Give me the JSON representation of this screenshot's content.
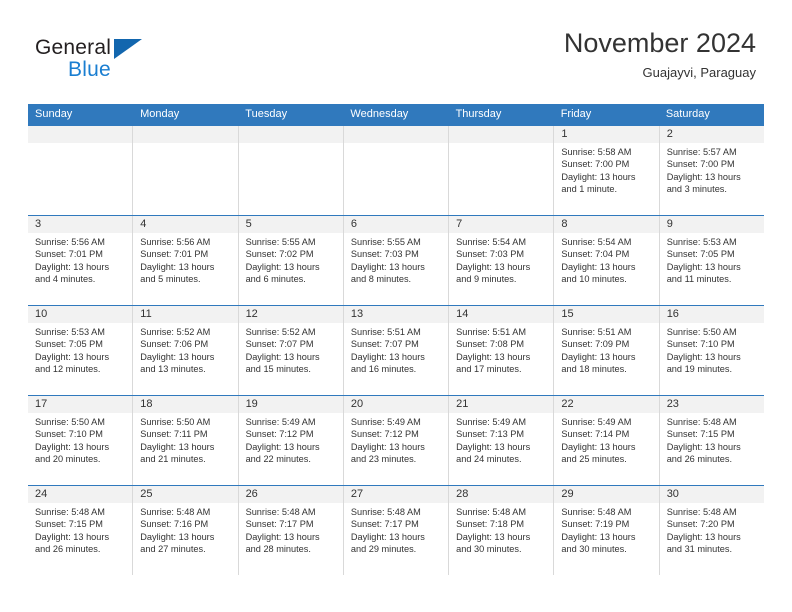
{
  "brand": {
    "name_part1": "General",
    "name_part2": "Blue",
    "accent_color": "#1a7ed1",
    "triangle_color": "#1266ae"
  },
  "header": {
    "title": "November 2024",
    "subtitle": "Guajayvi, Paraguay"
  },
  "calendar": {
    "header_bg": "#3079bd",
    "date_band_bg": "#f2f2f2",
    "weekdays": [
      "Sunday",
      "Monday",
      "Tuesday",
      "Wednesday",
      "Thursday",
      "Friday",
      "Saturday"
    ],
    "weeks": [
      [
        {
          "date": "",
          "sunrise": "",
          "sunset": "",
          "daylight": ""
        },
        {
          "date": "",
          "sunrise": "",
          "sunset": "",
          "daylight": ""
        },
        {
          "date": "",
          "sunrise": "",
          "sunset": "",
          "daylight": ""
        },
        {
          "date": "",
          "sunrise": "",
          "sunset": "",
          "daylight": ""
        },
        {
          "date": "",
          "sunrise": "",
          "sunset": "",
          "daylight": ""
        },
        {
          "date": "1",
          "sunrise": "Sunrise: 5:58 AM",
          "sunset": "Sunset: 7:00 PM",
          "daylight": "Daylight: 13 hours and 1 minute."
        },
        {
          "date": "2",
          "sunrise": "Sunrise: 5:57 AM",
          "sunset": "Sunset: 7:00 PM",
          "daylight": "Daylight: 13 hours and 3 minutes."
        }
      ],
      [
        {
          "date": "3",
          "sunrise": "Sunrise: 5:56 AM",
          "sunset": "Sunset: 7:01 PM",
          "daylight": "Daylight: 13 hours and 4 minutes."
        },
        {
          "date": "4",
          "sunrise": "Sunrise: 5:56 AM",
          "sunset": "Sunset: 7:01 PM",
          "daylight": "Daylight: 13 hours and 5 minutes."
        },
        {
          "date": "5",
          "sunrise": "Sunrise: 5:55 AM",
          "sunset": "Sunset: 7:02 PM",
          "daylight": "Daylight: 13 hours and 6 minutes."
        },
        {
          "date": "6",
          "sunrise": "Sunrise: 5:55 AM",
          "sunset": "Sunset: 7:03 PM",
          "daylight": "Daylight: 13 hours and 8 minutes."
        },
        {
          "date": "7",
          "sunrise": "Sunrise: 5:54 AM",
          "sunset": "Sunset: 7:03 PM",
          "daylight": "Daylight: 13 hours and 9 minutes."
        },
        {
          "date": "8",
          "sunrise": "Sunrise: 5:54 AM",
          "sunset": "Sunset: 7:04 PM",
          "daylight": "Daylight: 13 hours and 10 minutes."
        },
        {
          "date": "9",
          "sunrise": "Sunrise: 5:53 AM",
          "sunset": "Sunset: 7:05 PM",
          "daylight": "Daylight: 13 hours and 11 minutes."
        }
      ],
      [
        {
          "date": "10",
          "sunrise": "Sunrise: 5:53 AM",
          "sunset": "Sunset: 7:05 PM",
          "daylight": "Daylight: 13 hours and 12 minutes."
        },
        {
          "date": "11",
          "sunrise": "Sunrise: 5:52 AM",
          "sunset": "Sunset: 7:06 PM",
          "daylight": "Daylight: 13 hours and 13 minutes."
        },
        {
          "date": "12",
          "sunrise": "Sunrise: 5:52 AM",
          "sunset": "Sunset: 7:07 PM",
          "daylight": "Daylight: 13 hours and 15 minutes."
        },
        {
          "date": "13",
          "sunrise": "Sunrise: 5:51 AM",
          "sunset": "Sunset: 7:07 PM",
          "daylight": "Daylight: 13 hours and 16 minutes."
        },
        {
          "date": "14",
          "sunrise": "Sunrise: 5:51 AM",
          "sunset": "Sunset: 7:08 PM",
          "daylight": "Daylight: 13 hours and 17 minutes."
        },
        {
          "date": "15",
          "sunrise": "Sunrise: 5:51 AM",
          "sunset": "Sunset: 7:09 PM",
          "daylight": "Daylight: 13 hours and 18 minutes."
        },
        {
          "date": "16",
          "sunrise": "Sunrise: 5:50 AM",
          "sunset": "Sunset: 7:10 PM",
          "daylight": "Daylight: 13 hours and 19 minutes."
        }
      ],
      [
        {
          "date": "17",
          "sunrise": "Sunrise: 5:50 AM",
          "sunset": "Sunset: 7:10 PM",
          "daylight": "Daylight: 13 hours and 20 minutes."
        },
        {
          "date": "18",
          "sunrise": "Sunrise: 5:50 AM",
          "sunset": "Sunset: 7:11 PM",
          "daylight": "Daylight: 13 hours and 21 minutes."
        },
        {
          "date": "19",
          "sunrise": "Sunrise: 5:49 AM",
          "sunset": "Sunset: 7:12 PM",
          "daylight": "Daylight: 13 hours and 22 minutes."
        },
        {
          "date": "20",
          "sunrise": "Sunrise: 5:49 AM",
          "sunset": "Sunset: 7:12 PM",
          "daylight": "Daylight: 13 hours and 23 minutes."
        },
        {
          "date": "21",
          "sunrise": "Sunrise: 5:49 AM",
          "sunset": "Sunset: 7:13 PM",
          "daylight": "Daylight: 13 hours and 24 minutes."
        },
        {
          "date": "22",
          "sunrise": "Sunrise: 5:49 AM",
          "sunset": "Sunset: 7:14 PM",
          "daylight": "Daylight: 13 hours and 25 minutes."
        },
        {
          "date": "23",
          "sunrise": "Sunrise: 5:48 AM",
          "sunset": "Sunset: 7:15 PM",
          "daylight": "Daylight: 13 hours and 26 minutes."
        }
      ],
      [
        {
          "date": "24",
          "sunrise": "Sunrise: 5:48 AM",
          "sunset": "Sunset: 7:15 PM",
          "daylight": "Daylight: 13 hours and 26 minutes."
        },
        {
          "date": "25",
          "sunrise": "Sunrise: 5:48 AM",
          "sunset": "Sunset: 7:16 PM",
          "daylight": "Daylight: 13 hours and 27 minutes."
        },
        {
          "date": "26",
          "sunrise": "Sunrise: 5:48 AM",
          "sunset": "Sunset: 7:17 PM",
          "daylight": "Daylight: 13 hours and 28 minutes."
        },
        {
          "date": "27",
          "sunrise": "Sunrise: 5:48 AM",
          "sunset": "Sunset: 7:17 PM",
          "daylight": "Daylight: 13 hours and 29 minutes."
        },
        {
          "date": "28",
          "sunrise": "Sunrise: 5:48 AM",
          "sunset": "Sunset: 7:18 PM",
          "daylight": "Daylight: 13 hours and 30 minutes."
        },
        {
          "date": "29",
          "sunrise": "Sunrise: 5:48 AM",
          "sunset": "Sunset: 7:19 PM",
          "daylight": "Daylight: 13 hours and 30 minutes."
        },
        {
          "date": "30",
          "sunrise": "Sunrise: 5:48 AM",
          "sunset": "Sunset: 7:20 PM",
          "daylight": "Daylight: 13 hours and 31 minutes."
        }
      ]
    ]
  }
}
